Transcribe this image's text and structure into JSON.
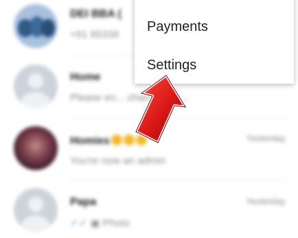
{
  "chats": [
    {
      "name": "DEI BBA (",
      "subtitle": "+91 85339",
      "time": ""
    },
    {
      "name": "Home",
      "subtitle": "Please en...   cham se ph...",
      "time": ""
    },
    {
      "name": "Homies",
      "subtitle": "You're now an admin",
      "time": "Yesterday"
    },
    {
      "name": "Papa",
      "subtitle": "Photo",
      "time": "Yesterday"
    }
  ],
  "menu": {
    "items": [
      {
        "label": "Payments"
      },
      {
        "label": "Settings"
      }
    ]
  },
  "annotation": {
    "arrow_color": "#d81616",
    "arrow_icon": "red-arrow-icon"
  }
}
